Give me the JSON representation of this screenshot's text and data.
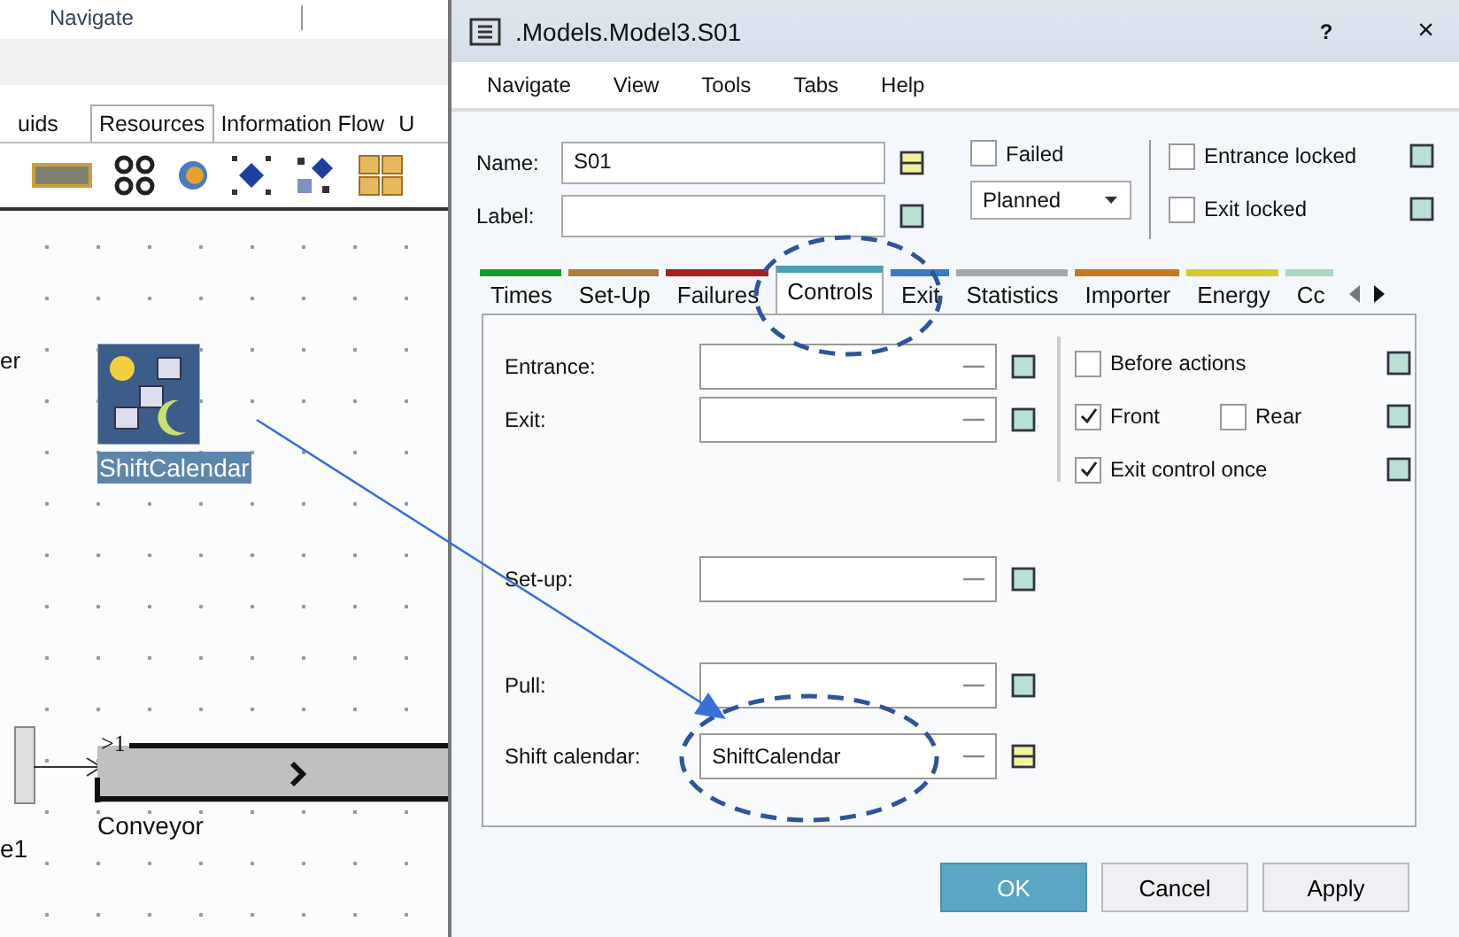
{
  "app": {
    "top_menu": "Navigate",
    "library_tabs": [
      {
        "label": "uids",
        "selected": false
      },
      {
        "label": "Resources",
        "selected": true
      },
      {
        "label": "Information Flow",
        "selected": false
      },
      {
        "label": "U",
        "selected": false
      }
    ],
    "canvas": {
      "partial_label_top": "er",
      "shift_calendar": {
        "label": "ShiftCalendar",
        "selected": true
      },
      "conveyor": {
        "label": "Conveyor",
        "entrance_mark": ">1"
      },
      "partial_label_bottom": "e1"
    }
  },
  "dialog": {
    "title": ".Models.Model3.S01",
    "help": "?",
    "close": "×",
    "menu": [
      "Navigate",
      "View",
      "Tools",
      "Tabs",
      "Help"
    ],
    "name": {
      "label": "Name:",
      "value": "S01",
      "inherited": false
    },
    "label": {
      "label": "Label:",
      "inherited": true
    },
    "failed": {
      "label": "Failed",
      "checked": false
    },
    "failure_mode": {
      "value": "Planned"
    },
    "entrance_locked": {
      "label": "Entrance locked",
      "checked": false,
      "inherited": true
    },
    "exit_locked": {
      "label": "Exit locked",
      "checked": false,
      "inherited": true
    },
    "tabs": [
      {
        "label": "Times",
        "color": "#1a9a2a",
        "selected": false
      },
      {
        "label": "Set-Up",
        "color": "#b07a3a",
        "selected": false
      },
      {
        "label": "Failures",
        "color": "#a52020",
        "selected": false
      },
      {
        "label": "Controls",
        "color": "#4aa0b0",
        "selected": true
      },
      {
        "label": "Exit",
        "color": "#3a7ac0",
        "selected": false
      },
      {
        "label": "Statistics",
        "color": "#a8a8a8",
        "selected": false
      },
      {
        "label": "Importer",
        "color": "#c8781e",
        "selected": false
      },
      {
        "label": "Energy",
        "color": "#d8c830",
        "selected": false
      },
      {
        "label": "Cc",
        "color": "#a8d8c0",
        "selected": false
      }
    ],
    "controls": [
      {
        "label": "Entrance:",
        "inherited": true
      },
      {
        "label": "Exit:",
        "inherited": true
      },
      {
        "label": "Set-up:",
        "inherited": true
      },
      {
        "label": "Pull:",
        "inherited": true
      },
      {
        "label": "Shift calendar:",
        "value": "ShiftCalendar",
        "inherited": false
      }
    ],
    "options": [
      {
        "label": "Before actions",
        "checked": false
      },
      {
        "label": "Front",
        "checked": true,
        "extra": {
          "label": "Rear",
          "checked": false
        }
      },
      {
        "label": "Exit control once",
        "checked": true
      }
    ],
    "buttons": [
      {
        "label": "OK",
        "kind": "primary"
      },
      {
        "label": "Cancel",
        "kind": "normal"
      },
      {
        "label": "Apply",
        "kind": "normal"
      }
    ]
  }
}
